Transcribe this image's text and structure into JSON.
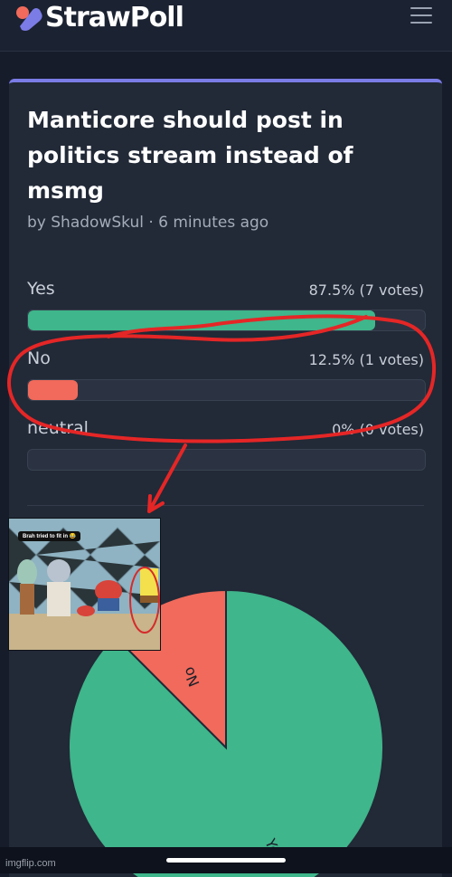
{
  "app": {
    "brand": "StrawPoll",
    "menu_icon": "hamburger-menu-icon",
    "accent": "#7b7ce6"
  },
  "poll": {
    "title": "Manticore should post in politics stream instead of msmg",
    "author_line": "by ShadowSkul · 6 minutes ago",
    "options": [
      {
        "label": "Yes",
        "stat": "87.5% (7 votes)",
        "percent": 87.5,
        "color": "#3fb68b"
      },
      {
        "label": "No",
        "stat": "12.5% (1 votes)",
        "percent": 12.5,
        "color": "#f16a5b"
      },
      {
        "label": "neutral",
        "stat": "0% (0 votes)",
        "percent": 0,
        "color": "#6b7280"
      }
    ]
  },
  "chart_data": {
    "type": "pie",
    "categories": [
      "Yes",
      "No",
      "neutral"
    ],
    "values": [
      87.5,
      12.5,
      0
    ],
    "labels_shown": [
      "No",
      "Yes"
    ],
    "colors": [
      "#3fb68b",
      "#f16a5b"
    ]
  },
  "meme": {
    "caption": "Brah tried to fit in 😂"
  },
  "watermark": "imgflip.com"
}
